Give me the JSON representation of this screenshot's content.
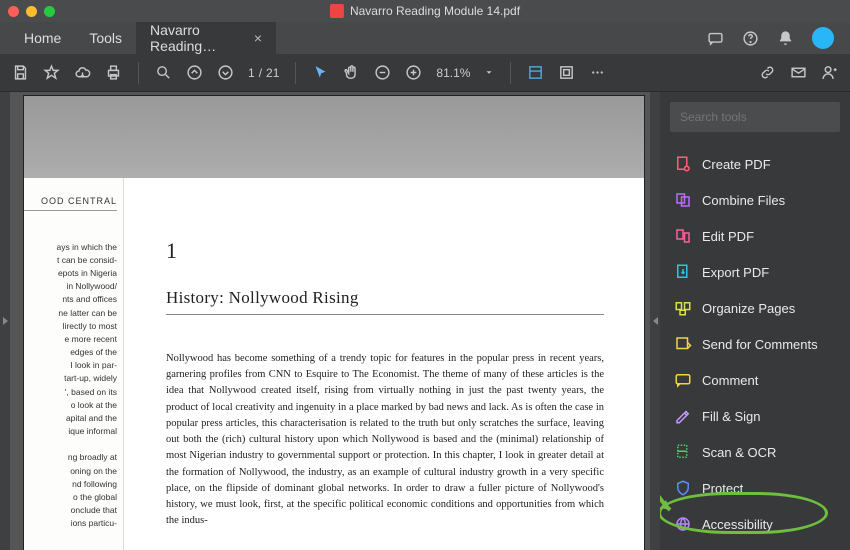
{
  "titlebar": {
    "filename": "Navarro Reading Module 14.pdf"
  },
  "tabs": {
    "home": "Home",
    "tools": "Tools",
    "doc": "Navarro Reading…"
  },
  "toolbar": {
    "page_current": "1",
    "page_sep": "/",
    "page_total": "21",
    "zoom": "81.1%"
  },
  "tools_panel": {
    "search_placeholder": "Search tools",
    "items": [
      {
        "label": "Create PDF",
        "color": "#ff5e7a"
      },
      {
        "label": "Combine Files",
        "color": "#bb6bff"
      },
      {
        "label": "Edit PDF",
        "color": "#ff5e9b"
      },
      {
        "label": "Export PDF",
        "color": "#2ec4f0"
      },
      {
        "label": "Organize Pages",
        "color": "#d9e24a"
      },
      {
        "label": "Send for Comments",
        "color": "#f2d541"
      },
      {
        "label": "Comment",
        "color": "#f2d541"
      },
      {
        "label": "Fill & Sign",
        "color": "#c49bff"
      },
      {
        "label": "Scan & OCR",
        "color": "#4ad46b"
      },
      {
        "label": "Protect",
        "color": "#5a8cff"
      },
      {
        "label": "Accessibility",
        "color": "#b388ff"
      }
    ]
  },
  "document": {
    "left_header": "OOD CENTRAL",
    "left_fragment": "ays in which the\nt can be consid-\nepots in Nigeria\n in Nollywood/\nnts and offices\nne latter can be\nlirectly to most\ne more recent\n edges of the\nI look in par-\ntart-up, widely\n', based on its\no look at the\napital and the\nique informal\n\nng broadly at\noning on the\nnd following\no the global\nonclude that\nions particu-",
    "chapter_number": "1",
    "chapter_title": "History: Nollywood Rising",
    "body": "Nollywood has become something of a trendy topic for features in the popular press in recent years, garnering profiles from CNN to Esquire to The Economist. The theme of many of these articles is the idea that Nollywood created itself, rising from virtually nothing in just the past twenty years, the product of local creativity and ingenuity in a place marked by bad news and lack. As is often the case in popular press articles, this characterisation is related to the truth but only scratches the surface, leaving out both the (rich) cultural history upon which Nollywood is based and the (minimal) relationship of most Nigerian industry to governmental support or protection. In this chapter, I look in greater detail at the formation of Nollywood, the industry, as an example of cultural industry growth in a very specific place, on the flipside of dominant global networks. In order to draw a fuller picture of Nollywood's history, we must look, first, at the specific political economic conditions and opportunities from which the indus-"
  }
}
